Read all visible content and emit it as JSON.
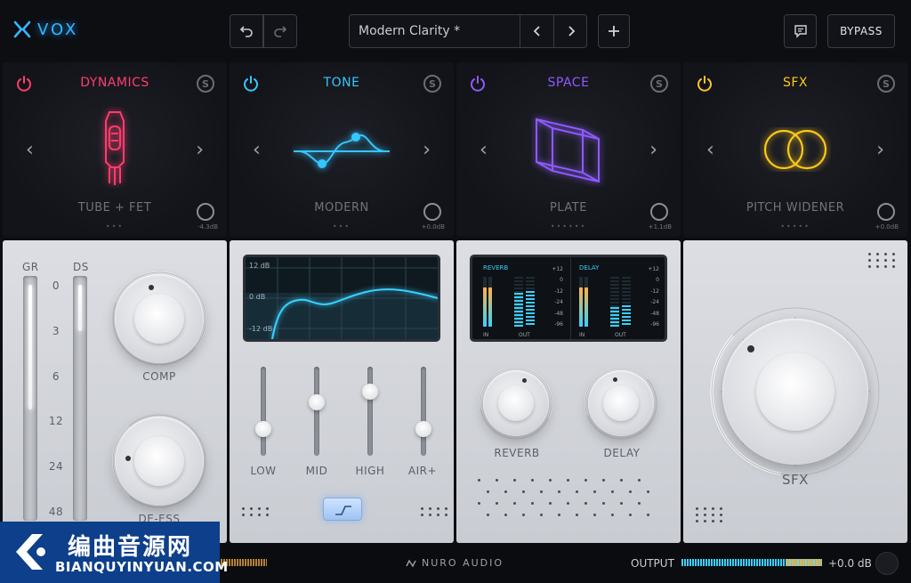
{
  "app": {
    "logo_text": "VOX",
    "accent": "#35b6ff"
  },
  "toolbar": {
    "undo_icon": "undo-icon",
    "redo_icon": "redo-icon",
    "preset_name": "Modern Clarity *",
    "prev_icon": "chevron-left-icon",
    "next_icon": "chevron-right-icon",
    "add_icon": "plus-icon",
    "chat_icon": "chat-icon",
    "bypass_label": "BYPASS"
  },
  "modules": [
    {
      "title": "DYNAMICS",
      "color": "#ff3d6e",
      "mode": "TUBE + FET",
      "db": "-4.3dB",
      "solo": "S",
      "dots": "•••",
      "active_dot": 3
    },
    {
      "title": "TONE",
      "color": "#35c6ff",
      "mode": "MODERN",
      "db": "+0.0dB",
      "solo": "S",
      "dots": "•••",
      "active_dot": 1
    },
    {
      "title": "SPACE",
      "color": "#8e5bff",
      "mode": "PLATE",
      "db": "+1.1dB",
      "solo": "S",
      "dots": "••••••",
      "active_dot": 3
    },
    {
      "title": "SFX",
      "color": "#ffc81a",
      "mode": "PITCH WIDENER",
      "db": "+0.0dB",
      "solo": "S",
      "dots": "•••••",
      "active_dot": 1
    }
  ],
  "dynamics": {
    "gr_label": "GR",
    "ds_label": "DS",
    "scale": [
      "0",
      "3",
      "6",
      "12",
      "24",
      "48"
    ],
    "comp_label": "COMP",
    "deess_label": "DE-ESS"
  },
  "tone": {
    "eq_labels": [
      "12 dB",
      "0 dB",
      "-12 dB"
    ],
    "faders": [
      {
        "label": "LOW",
        "level": 0.3
      },
      {
        "label": "MID",
        "level": 0.6
      },
      {
        "label": "HIGH",
        "level": 0.72
      },
      {
        "label": "AIR+",
        "level": 0.3
      }
    ]
  },
  "space": {
    "reverb_meter_label": "REVERB",
    "delay_meter_label": "DELAY",
    "in_label": "IN",
    "out_label": "OUT",
    "meter_scale": [
      "+12",
      "0",
      "-12",
      "-24",
      "-48",
      "-96"
    ],
    "reverb_label": "REVERB",
    "delay_label": "DELAY"
  },
  "sfx": {
    "knob_label": "SFX"
  },
  "footer": {
    "brand": "NURO AUDIO",
    "output_label": "OUTPUT",
    "output_value": "+0.0 dB"
  },
  "watermark": {
    "cn": "编曲音源网",
    "en": "BIANQUYINYUAN.COM"
  }
}
